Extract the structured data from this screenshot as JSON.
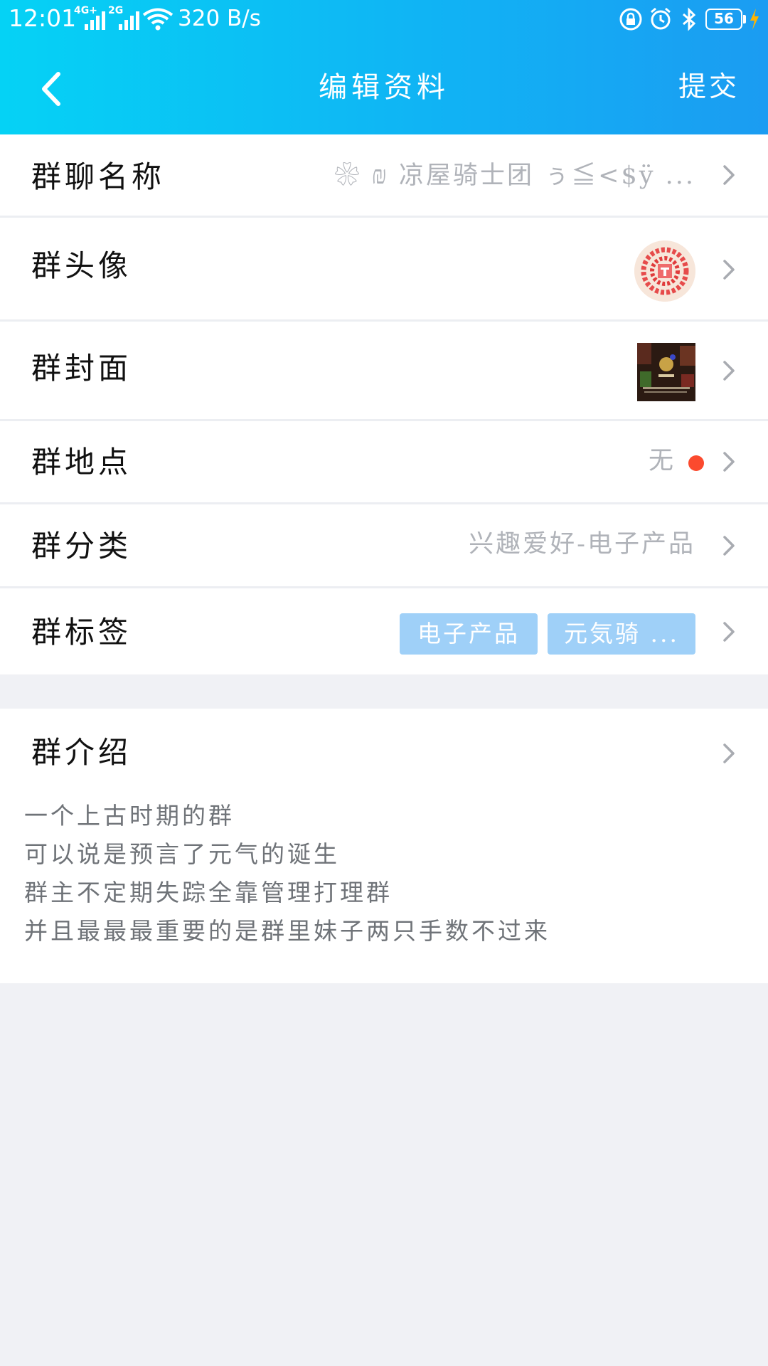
{
  "status_bar": {
    "time": "12:01",
    "network_1": "4G+",
    "network_2": "2G",
    "speed": "320 B/s",
    "battery": "56",
    "icons": [
      "signal-4g-icon",
      "signal-2g-icon",
      "wifi-icon",
      "lock-rotation-icon",
      "alarm-icon",
      "bluetooth-icon",
      "battery-icon",
      "charging-icon"
    ]
  },
  "nav": {
    "title": "编辑资料",
    "submit": "提交",
    "back_icon": "chevron-left-icon"
  },
  "rows": {
    "name": {
      "label": "群聊名称",
      "value": "❀ ₪ 凉屋骑士团 ぅ≦<$ÿ ..."
    },
    "avatar": {
      "label": "群头像"
    },
    "cover": {
      "label": "群封面"
    },
    "location": {
      "label": "群地点",
      "value": "无"
    },
    "category": {
      "label": "群分类",
      "value": "兴趣爱好-电子产品"
    },
    "tags": {
      "label": "群标签",
      "items": [
        "电子产品",
        "元気骑 ..."
      ]
    },
    "intro": {
      "label": "群介绍",
      "lines": [
        "一个上古时期的群",
        "可以说是预言了元气的诞生",
        "群主不定期失踪全靠管理打理群",
        "并且最最最重要的是群里妹子两只手数不过来"
      ]
    }
  },
  "colors": {
    "header_start": "#05d2f5",
    "header_end": "#1b9cf2",
    "tag_bg": "#9fd0f8",
    "badge_dot": "#fb4a2e",
    "page_bg": "#f0f1f5"
  }
}
